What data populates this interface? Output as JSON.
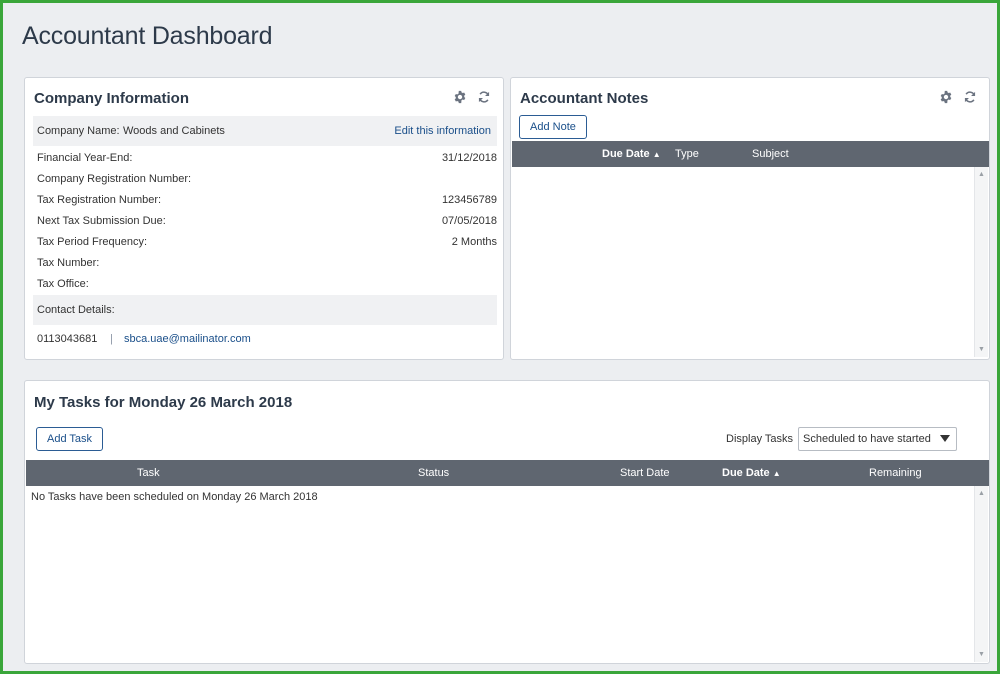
{
  "page": {
    "title": "Accountant Dashboard"
  },
  "company_info": {
    "title": "Company Information",
    "company_name_label": "Company Name:",
    "company_name_value": "Woods and Cabinets",
    "edit_link": "Edit this information",
    "rows": [
      {
        "label": "Financial Year-End:",
        "value": "31/12/2018"
      },
      {
        "label": "Company Registration Number:",
        "value": ""
      },
      {
        "label": "Tax Registration Number:",
        "value": "123456789"
      },
      {
        "label": "Next Tax Submission Due:",
        "value": "07/05/2018"
      },
      {
        "label": "Tax Period Frequency:",
        "value": "2 Months"
      },
      {
        "label": "Tax Number:",
        "value": ""
      },
      {
        "label": "Tax Office:",
        "value": ""
      }
    ],
    "contact_label": "Contact Details:",
    "phone": "0113043681",
    "separator": "|",
    "email": "sbca.uae@mailinator.com"
  },
  "notes": {
    "title": "Accountant Notes",
    "add_button": "Add Note",
    "columns": {
      "due_date": "Due Date",
      "type": "Type",
      "subject": "Subject"
    }
  },
  "tasks": {
    "title": "My Tasks for Monday 26 March 2018",
    "add_button": "Add Task",
    "display_label": "Display Tasks",
    "display_selected": "Scheduled to have started",
    "columns": {
      "task": "Task",
      "status": "Status",
      "start_date": "Start Date",
      "due_date": "Due Date",
      "remaining": "Remaining"
    },
    "empty_message": "No Tasks have been scheduled on Monday 26 March 2018"
  },
  "icons": {
    "settings": "gear-icon",
    "refresh": "refresh-icon",
    "sort": "sort-asc-icon"
  },
  "colors": {
    "frame": "#3aa63a",
    "header_bar": "#5f6670",
    "link": "#1a4f8a"
  }
}
